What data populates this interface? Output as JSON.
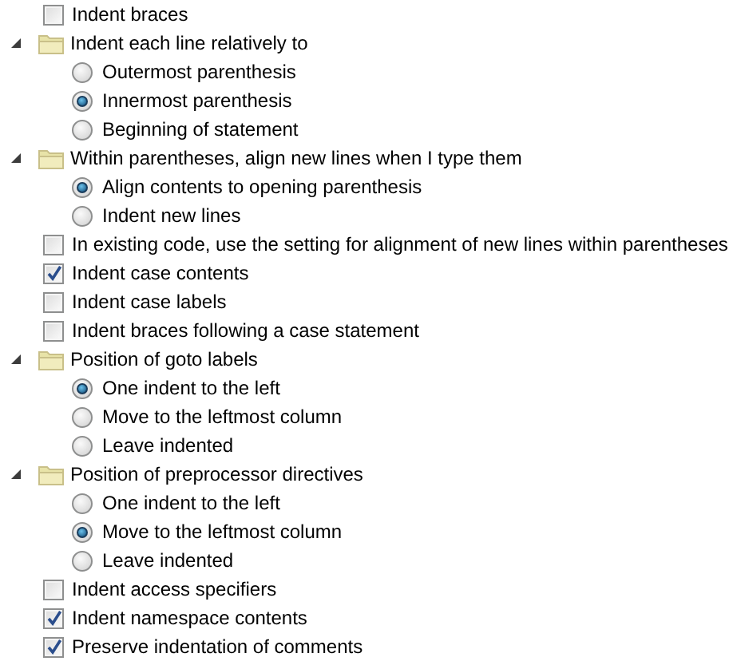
{
  "items": [
    {
      "kind": "checkbox",
      "label": "Indent braces",
      "checked": false
    },
    {
      "kind": "group",
      "label": "Indent each line relatively to",
      "expanded": true,
      "children": [
        {
          "kind": "radio",
          "label": "Outermost parenthesis",
          "selected": false
        },
        {
          "kind": "radio",
          "label": "Innermost parenthesis",
          "selected": true
        },
        {
          "kind": "radio",
          "label": "Beginning of statement",
          "selected": false
        }
      ]
    },
    {
      "kind": "group",
      "label": "Within parentheses, align new lines when I type them",
      "expanded": true,
      "children": [
        {
          "kind": "radio",
          "label": "Align contents to opening parenthesis",
          "selected": true
        },
        {
          "kind": "radio",
          "label": "Indent new lines",
          "selected": false
        }
      ]
    },
    {
      "kind": "checkbox",
      "label": "In existing code, use the setting for alignment of new lines within parentheses",
      "checked": false
    },
    {
      "kind": "checkbox",
      "label": "Indent case contents",
      "checked": true
    },
    {
      "kind": "checkbox",
      "label": "Indent case labels",
      "checked": false
    },
    {
      "kind": "checkbox",
      "label": "Indent braces following a case statement",
      "checked": false
    },
    {
      "kind": "group",
      "label": "Position of goto labels",
      "expanded": true,
      "children": [
        {
          "kind": "radio",
          "label": "One indent to the left",
          "selected": true
        },
        {
          "kind": "radio",
          "label": "Move to the leftmost column",
          "selected": false
        },
        {
          "kind": "radio",
          "label": "Leave indented",
          "selected": false
        }
      ]
    },
    {
      "kind": "group",
      "label": "Position of preprocessor directives",
      "expanded": true,
      "children": [
        {
          "kind": "radio",
          "label": "One indent to the left",
          "selected": false
        },
        {
          "kind": "radio",
          "label": "Move to the leftmost column",
          "selected": true
        },
        {
          "kind": "radio",
          "label": "Leave indented",
          "selected": false
        }
      ]
    },
    {
      "kind": "checkbox",
      "label": "Indent access specifiers",
      "checked": false
    },
    {
      "kind": "checkbox",
      "label": "Indent namespace contents",
      "checked": true
    },
    {
      "kind": "checkbox",
      "label": "Preserve indentation of comments",
      "checked": true
    }
  ]
}
